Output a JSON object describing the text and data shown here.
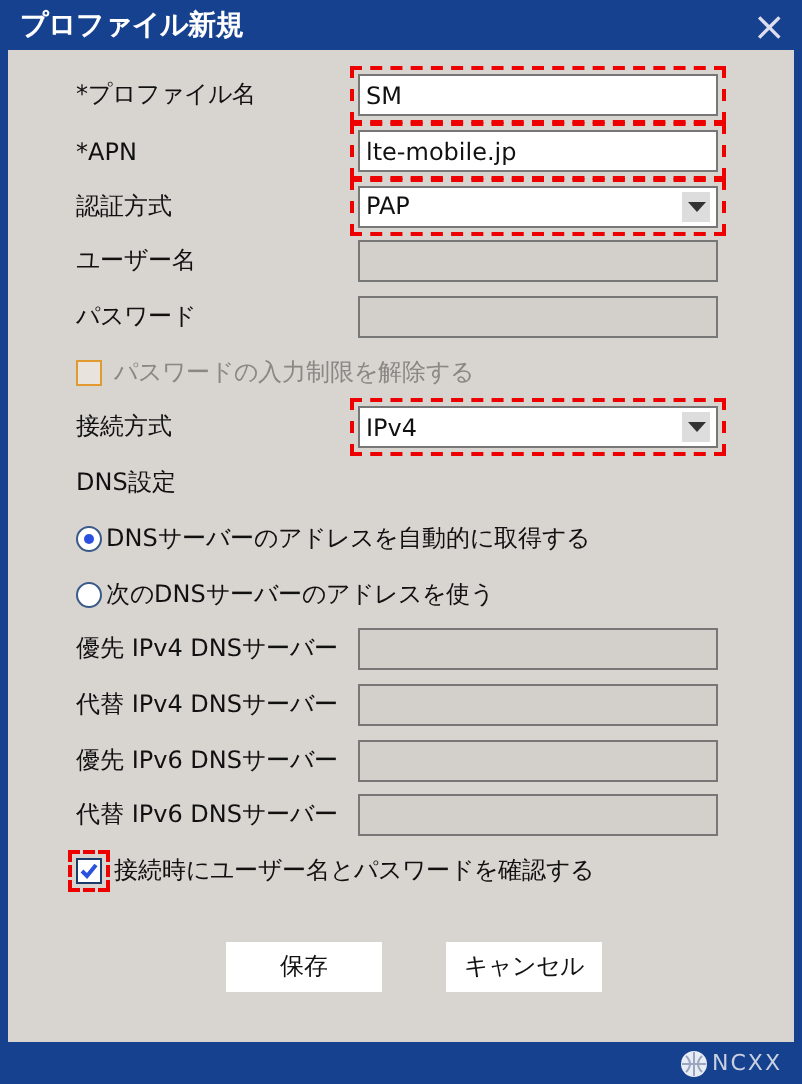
{
  "window": {
    "title": "プロファイル新規",
    "close": "×"
  },
  "rows": [
    {
      "kind": "text",
      "label": "*プロファイル名",
      "value": "SM",
      "disabled": false,
      "highlighted": true
    },
    {
      "kind": "text",
      "label": "*APN",
      "value": "lte-mobile.jp",
      "disabled": false,
      "highlighted": true
    },
    {
      "kind": "select",
      "label": "認証方式",
      "value": "PAP",
      "disabled": false,
      "highlighted": true
    },
    {
      "kind": "text",
      "label": "ユーザー名",
      "disabled": true,
      "highlighted": false
    },
    {
      "kind": "text",
      "label": "パスワード",
      "disabled": true,
      "highlighted": false
    },
    {
      "kind": "checkbox",
      "label": "パスワードの入力制限を解除する",
      "checked": false,
      "disabled": true,
      "highlighted": false
    },
    {
      "kind": "select",
      "label": "接続方式",
      "value": "IPv4",
      "disabled": false,
      "highlighted": true
    },
    {
      "kind": "heading",
      "label": "DNS設定"
    },
    {
      "kind": "radio",
      "label": "DNSサーバーのアドレスを自動的に取得する",
      "selected": true
    },
    {
      "kind": "radio",
      "label": "次のDNSサーバーのアドレスを使う",
      "selected": false
    },
    {
      "kind": "text",
      "label": "優先 IPv4 DNSサーバー",
      "disabled": true,
      "highlighted": false
    },
    {
      "kind": "text",
      "label": "代替 IPv4 DNSサーバー",
      "disabled": true,
      "highlighted": false
    },
    {
      "kind": "text",
      "label": "優先 IPv6 DNSサーバー",
      "disabled": true,
      "highlighted": false
    },
    {
      "kind": "text",
      "label": "代替 IPv6 DNSサーバー",
      "disabled": true,
      "highlighted": false
    },
    {
      "kind": "checkbox",
      "label": "接続時にユーザー名とパスワードを確認する",
      "checked": true,
      "disabled": false,
      "highlighted": true
    }
  ],
  "buttons": [
    "保存",
    "キャンセル"
  ],
  "footer": {
    "logo": "NCXX"
  }
}
